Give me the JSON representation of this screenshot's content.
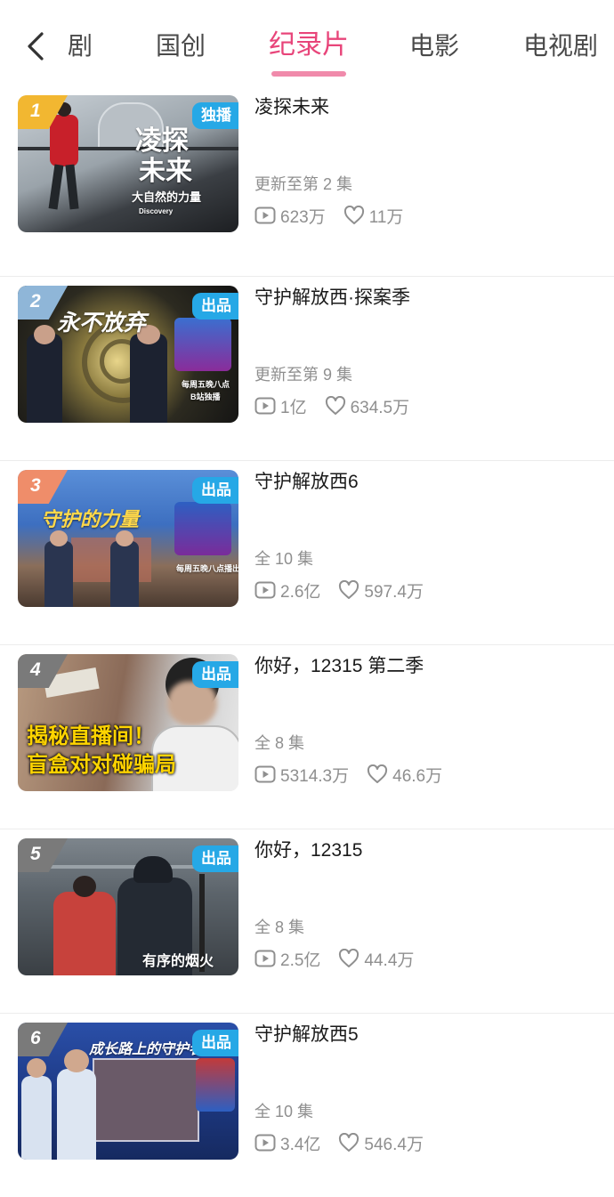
{
  "nav": {
    "tabs": [
      {
        "label": "剧"
      },
      {
        "label": "国创"
      },
      {
        "label": "纪录片"
      },
      {
        "label": "电影"
      },
      {
        "label": "电视剧"
      }
    ],
    "active_tab": "纪录片",
    "active_color": "#e8457a"
  },
  "items": [
    {
      "rank": "1",
      "rank_color": "#f2b731",
      "badge": "独播",
      "title": "凌探未来",
      "episodes": "更新至第 2 集",
      "plays": "623万",
      "likes": "11万",
      "poster_text": [
        "凌探",
        "未来",
        "大自然的力量",
        "Discovery"
      ]
    },
    {
      "rank": "2",
      "rank_color": "#8fb6d8",
      "badge": "出品",
      "title": "守护解放西·探案季",
      "episodes": "更新至第 9 集",
      "plays": "1亿",
      "likes": "634.5万",
      "poster_text": [
        "永不放弃",
        "每周五晚八点",
        "B站独播"
      ]
    },
    {
      "rank": "3",
      "rank_color": "#ef8d6a",
      "badge": "出品",
      "title": "守护解放西6",
      "episodes": "全 10 集",
      "plays": "2.6亿",
      "likes": "597.4万",
      "poster_text": [
        "守护的力量",
        "每周五晚八点播出"
      ]
    },
    {
      "rank": "4",
      "rank_color": "#7a7a7a",
      "badge": "出品",
      "title": "你好，12315 第二季",
      "episodes": "全 8 集",
      "plays": "5314.3万",
      "likes": "46.6万",
      "poster_text": [
        "揭秘直播间！",
        "盲盒对对碰骗局"
      ]
    },
    {
      "rank": "5",
      "rank_color": "#7a7a7a",
      "badge": "出品",
      "title": "你好，12315",
      "episodes": "全 8 集",
      "plays": "2.5亿",
      "likes": "44.4万",
      "poster_text": [
        "有序的烟火"
      ]
    },
    {
      "rank": "6",
      "rank_color": "#7a7a7a",
      "badge": "出品",
      "title": "守护解放西5",
      "episodes": "全 10 集",
      "plays": "3.4亿",
      "likes": "546.4万",
      "poster_text": [
        "成长路上的守护者"
      ]
    }
  ]
}
